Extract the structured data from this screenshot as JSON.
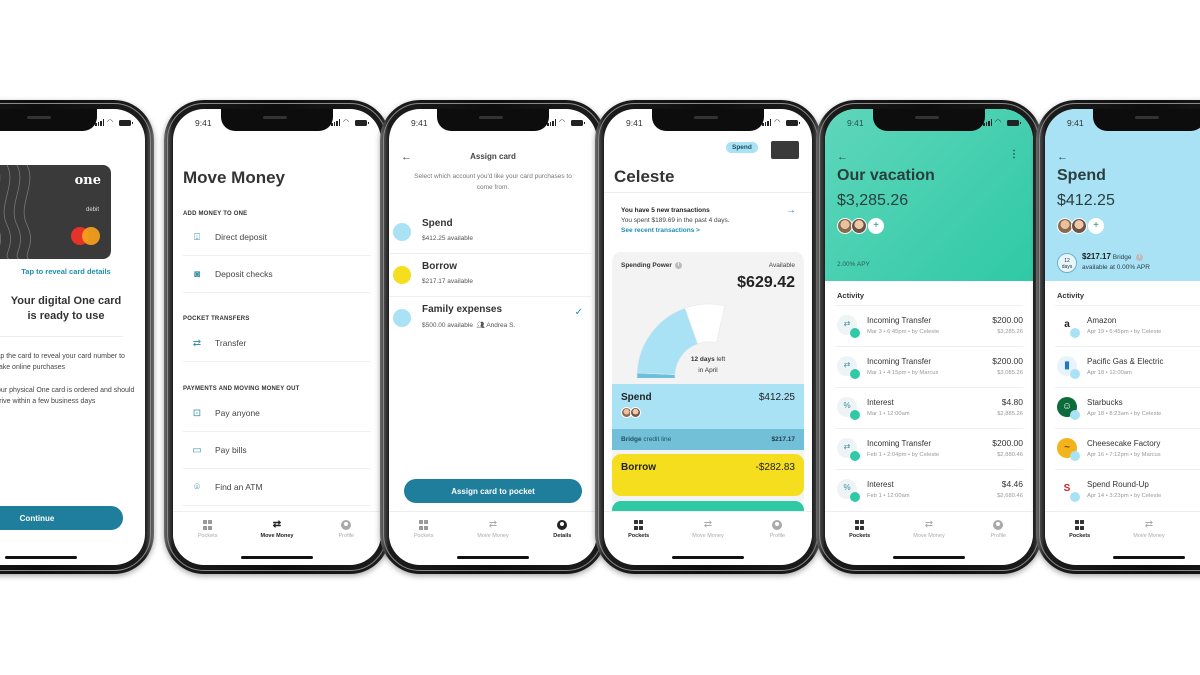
{
  "status": {
    "time": "9:41"
  },
  "colors": {
    "accent": "#1e7e9c",
    "spend_blue": "#a9e2f5",
    "bridge_blue": "#72bfd8",
    "borrow_yellow": "#f4de1d",
    "vacation_teal": "#2fc9a6"
  },
  "tabs": {
    "pockets": "Pockets",
    "move_money": "Move Money",
    "profile": "Profile",
    "details": "Details"
  },
  "screen_card": {
    "card_brand": "one",
    "card_type": "debit",
    "reveal_link": "Tap to reveal card details",
    "heading_line1": "Your digital One card",
    "heading_line2": "is ready to use",
    "note1": "Tap the card to reveal your card number to make online purchases",
    "note2": "Your physical One card is ordered and should arrive within a few business days",
    "continue_label": "Continue"
  },
  "screen_move_money": {
    "title": "Move Money",
    "sections": [
      {
        "header": "ADD MONEY TO ONE",
        "items": [
          {
            "icon": "direct-deposit-icon",
            "label": "Direct deposit"
          },
          {
            "icon": "camera-icon",
            "label": "Deposit checks"
          }
        ]
      },
      {
        "header": "POCKET TRANSFERS",
        "items": [
          {
            "icon": "transfer-icon",
            "label": "Transfer"
          }
        ]
      },
      {
        "header": "PAYMENTS AND MOVING MONEY OUT",
        "items": [
          {
            "icon": "pay-anyone-icon",
            "label": "Pay anyone"
          },
          {
            "icon": "bill-icon",
            "label": "Pay bills"
          },
          {
            "icon": "location-pin-icon",
            "label": "Find an ATM"
          }
        ]
      }
    ]
  },
  "screen_assign": {
    "title": "Assign card",
    "subtitle": "Select which account you'd like your card purchases to come from.",
    "accounts": [
      {
        "name": "Spend",
        "available": "$412.25 available",
        "color": "#a9e2f5",
        "selected": false
      },
      {
        "name": "Borrow",
        "available": "$217.17 available",
        "color": "#f4de1d",
        "selected": false
      },
      {
        "name": "Family expenses",
        "available": "$500.00 available",
        "shared_with": "Andrea S.",
        "color": "#a9e2f5",
        "selected": true
      }
    ],
    "button_label": "Assign card to pocket"
  },
  "screen_pockets": {
    "pill": "Spend",
    "name": "Celeste",
    "notice_title": "You have 5 new transactions",
    "notice_body": "You spent $189.69 in the past 4 days.",
    "notice_link": "See recent transactions >",
    "spending_power_label": "Spending Power",
    "available_label": "Available",
    "available_amount": "$629.42",
    "gauge": {
      "spent_fraction": 0.22,
      "available_fraction": 0.53,
      "remaining_fraction": 0.25
    },
    "days_left_bold": "12 days",
    "days_left_rest": " left",
    "days_left_line2": "in April",
    "spend": {
      "label": "Spend",
      "amount": "$412.25"
    },
    "bridge": {
      "label_bold": "Bridge",
      "label_rest": " credit line",
      "amount": "$217.17"
    },
    "borrow": {
      "label": "Borrow",
      "amount": "-$282.83"
    }
  },
  "screen_vacation": {
    "title": "Our vacation",
    "balance": "$3,285.26",
    "apy": "2.00% APY",
    "activity_label": "Activity",
    "activity": [
      {
        "icon": "transfer-icon",
        "name": "Incoming Transfer",
        "meta": "Mar 3 • 6:45pm • by Celeste",
        "amount": "$200.00",
        "balance": "$3,285.26"
      },
      {
        "icon": "transfer-icon",
        "name": "Incoming Transfer",
        "meta": "Mar 1 • 4:15pm • by Marcus",
        "amount": "$200.00",
        "balance": "$3,085.26"
      },
      {
        "icon": "percent-icon",
        "name": "Interest",
        "meta": "Mar 1 • 12:00am",
        "amount": "$4.80",
        "balance": "$2,885.26"
      },
      {
        "icon": "transfer-icon",
        "name": "Incoming Transfer",
        "meta": "Feb 1 • 2:04pm • by Celeste",
        "amount": "$200.00",
        "balance": "$2,880.46"
      },
      {
        "icon": "percent-icon",
        "name": "Interest",
        "meta": "Feb 1 • 12:00am",
        "amount": "$4.46",
        "balance": "$2,680.46"
      }
    ]
  },
  "screen_spend": {
    "title": "Spend",
    "balance": "$412.25",
    "bridge_days_num": "12",
    "bridge_days_unit": "days",
    "bridge_amount": "$217.17",
    "bridge_label": " Bridge",
    "bridge_apr": "available at 0.00% APR",
    "activity_label": "Activity",
    "activity": [
      {
        "logo": "amazon-logo",
        "name": "Amazon",
        "meta": "Apr 19 • 6:45pm • by Celeste"
      },
      {
        "logo": "pge-logo",
        "name": "Pacific Gas & Electric",
        "meta": "Apr 18 • 12:00am"
      },
      {
        "logo": "starbucks-logo",
        "name": "Starbucks",
        "meta": "Apr 18 • 8:23am • by Celeste"
      },
      {
        "logo": "cheesecake-factory-logo",
        "name": "Cheesecake Factory",
        "meta": "Apr 16 • 7:12pm • by Marcus"
      },
      {
        "logo": "safeway-logo",
        "name": "Spend Round-Up",
        "meta": "Apr 14 • 3:23pm • by Celeste"
      }
    ]
  }
}
